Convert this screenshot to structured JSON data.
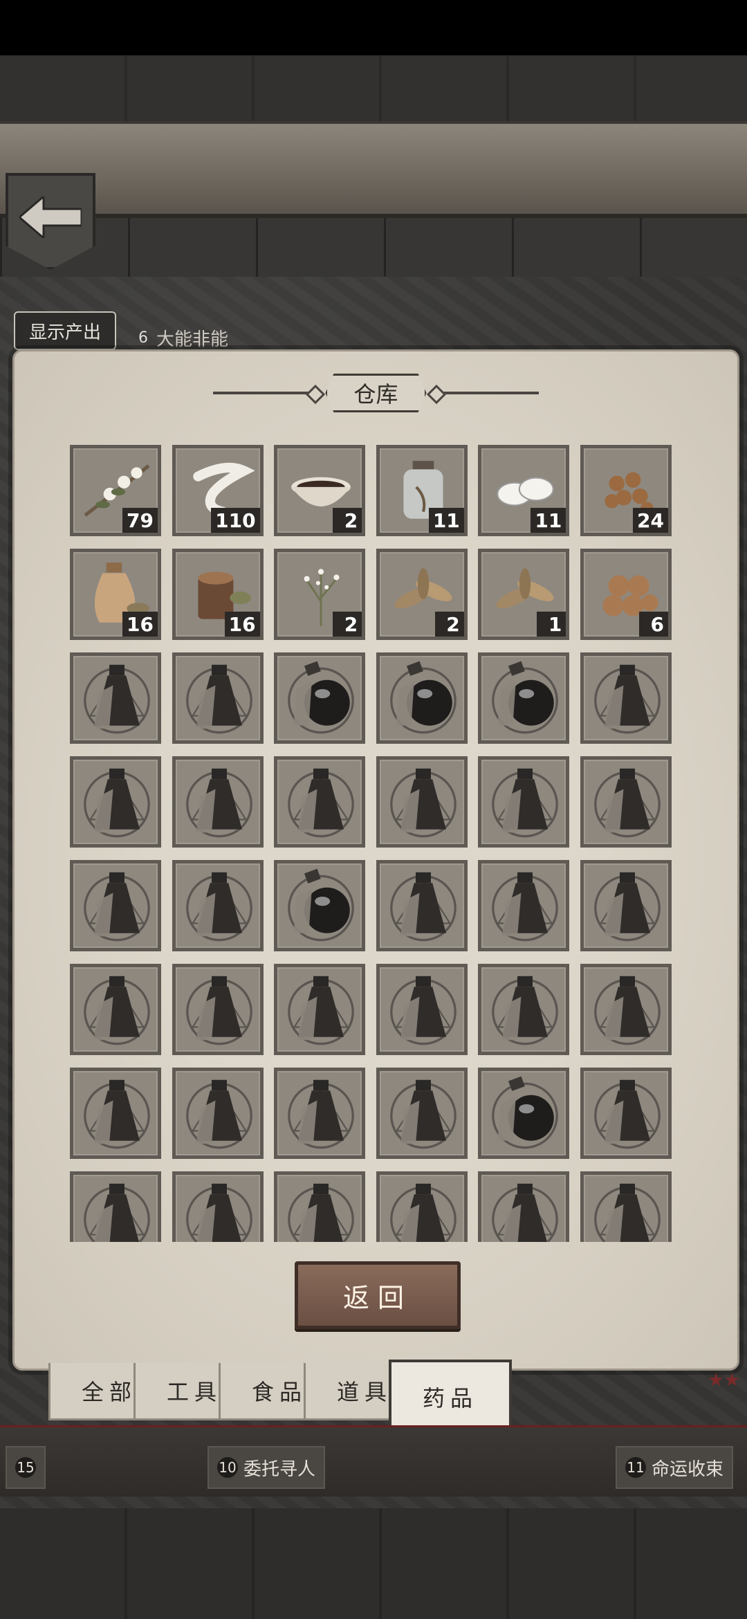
{
  "header": {
    "back_icon": "arrow-left-icon"
  },
  "map": {
    "show_output_label": "显示产出",
    "location_top": {
      "num": "6",
      "name": "大能非能"
    },
    "quests": [
      {
        "num": "15",
        "name": ""
      },
      {
        "num": "10",
        "name": "委托寻人"
      },
      {
        "num": "11",
        "name": "命运收束"
      }
    ]
  },
  "panel": {
    "title": "仓库",
    "items": [
      {
        "name": "flower-branch",
        "count": "79",
        "icon": "herb"
      },
      {
        "name": "white-ribbon",
        "count": "110",
        "icon": "ribbon"
      },
      {
        "name": "bowl-liquid",
        "count": "2",
        "icon": "bowl"
      },
      {
        "name": "glass-jar",
        "count": "11",
        "icon": "jar"
      },
      {
        "name": "white-tablets",
        "count": "11",
        "icon": "tablets"
      },
      {
        "name": "brown-beans",
        "count": "24",
        "icon": "beans"
      },
      {
        "name": "oil-jar-leaves",
        "count": "16",
        "icon": "pot"
      },
      {
        "name": "wood-block-leaves",
        "count": "16",
        "icon": "wood"
      },
      {
        "name": "white-flower-plant",
        "count": "2",
        "icon": "plant"
      },
      {
        "name": "green-leaves",
        "count": "2",
        "icon": "leaves"
      },
      {
        "name": "star-leaves",
        "count": "1",
        "icon": "leaves"
      },
      {
        "name": "brown-balls",
        "count": "6",
        "icon": "balls"
      }
    ],
    "locked_rows": [
      [
        "flask",
        "flask",
        "round-flask",
        "round-flask",
        "round-flask",
        "flask"
      ],
      [
        "flask",
        "flask",
        "flask",
        "flask",
        "flask",
        "flask"
      ],
      [
        "flask",
        "flask",
        "round-flask",
        "flask",
        "flask",
        "flask"
      ],
      [
        "flask",
        "flask",
        "flask",
        "flask",
        "flask",
        "flask"
      ],
      [
        "flask",
        "flask",
        "flask",
        "flask",
        "round-flask",
        "flask"
      ],
      [
        "flask",
        "flask",
        "flask",
        "flask",
        "flask",
        "flask"
      ]
    ],
    "return_label": "返回"
  },
  "tabs": [
    {
      "label": "全部",
      "active": false
    },
    {
      "label": "工具",
      "active": false
    },
    {
      "label": "食品",
      "active": false
    },
    {
      "label": "道具",
      "active": false
    },
    {
      "label": "药品",
      "active": true
    }
  ],
  "colors": {
    "panel_bg": "#d9d3c7",
    "slot_bg": "#8e887f",
    "count_bg": "#2b2826",
    "return_btn": "#7a5c4e"
  }
}
